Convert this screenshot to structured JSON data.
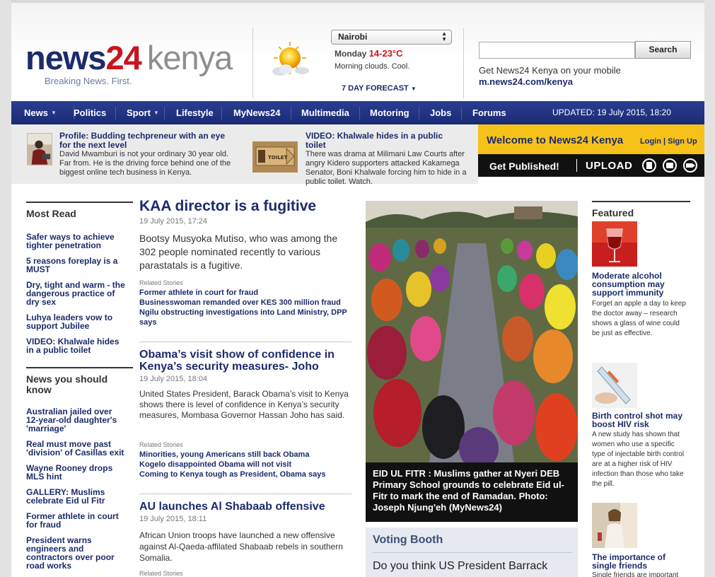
{
  "brand": {
    "logo_news": "news",
    "logo_24": "24",
    "logo_kenya": "kenya",
    "tagline": "Breaking News. First."
  },
  "weather": {
    "city": "Nairobi",
    "day": "Monday",
    "temp": "14-23°C",
    "condition": "Morning clouds. Cool.",
    "forecast_link": "7 DAY FORECAST",
    "icon": "sun-cloud-icon"
  },
  "search": {
    "value": "",
    "button": "Search"
  },
  "mobile": {
    "text": "Get News24 Kenya on your mobile",
    "link": "m.news24.com/kenya"
  },
  "nav": {
    "items": [
      "News",
      "Politics",
      "Sport",
      "Lifestyle",
      "MyNews24",
      "Multimedia",
      "Motoring",
      "Jobs",
      "Forums"
    ],
    "updated": "UPDATED: 19 July 2015, 18:20"
  },
  "teasers": [
    {
      "title": "Profile: Budding techpreneur with an eye for the next level",
      "body": "David Mwamburi is not your ordinary 30 year old. Far from. He is the driving force behind one of the biggest online tech business in Kenya."
    },
    {
      "title": "VIDEO: Khalwale hides in a public toilet",
      "body": "There was drama at Milimani Law Courts after angry Kidero supporters attacked Kakamega Senator, Boni Khalwale forcing him to hide in a public toilet. Watch.",
      "thumb_text": "TOILET"
    }
  ],
  "welcome": {
    "title": "Welcome to News24 Kenya",
    "login": "Login | Sign Up",
    "publish": "Get Published!",
    "upload": "UPLOAD"
  },
  "most_read": {
    "heading": "Most Read",
    "items": [
      "Safer ways to achieve tighter penetration",
      "5 reasons foreplay is a MUST",
      "Dry, tight and warm - the dangerous practice of dry sex",
      "Luhya leaders vow to support Jubilee",
      "VIDEO: Khalwale hides in a public toilet"
    ]
  },
  "should_know": {
    "heading": "News you should know",
    "items": [
      "Australian jailed over 12-year-old daughter's 'marriage'",
      "Real must move past 'division' of Casillas exit",
      "Wayne Rooney drops MLS hint",
      "GALLERY: Muslims celebrate Eid ul Fitr",
      "Former athlete in court for fraud",
      "President warns engineers and contractors over poor road works"
    ]
  },
  "articles": [
    {
      "headline": "KAA director is a fugitive",
      "date": "19 July 2015, 17:24",
      "summary": "Bootsy Musyoka Mutiso, who was among the 302 people nominated recently to various parastatals is a fugitive.",
      "related_label": "Related Stories",
      "related": [
        "Former athlete in court for fraud",
        "Businesswoman remanded over KES 300 million fraud",
        "Ngilu obstructing investigations into Land Ministry, DPP says"
      ]
    },
    {
      "headline": "Obama’s visit show of confidence in Kenya’s security measures- Joho",
      "date": "19 July 2015, 18:04",
      "summary": "United States President, Barack Obama’s visit to Kenya shows there is level of confidence in Kenya’s security measures, Mombasa Governor Hassan Joho has said.",
      "related_label": "Related Stories",
      "related": [
        "Minorities, young Americans still back Obama",
        "Kogelo disappointed Obama will not visit",
        "Coming to Kenya tough as President, Obama says"
      ]
    },
    {
      "headline": "AU launches Al Shabaab offensive",
      "date": "19 July 2015, 18:11",
      "summary": "African Union troops have launched a new offensive against Al-Qaeda-affilated Shabaab rebels in southern Somalia.",
      "related_label": "Related Stories"
    }
  ],
  "photo": {
    "caption": "EID UL FITR : Muslims gather at Nyeri DEB Primary School grounds to celebrate Eid ul-Fitr to mark the end of Ramadan. Photo: Joseph Njung'eh (MyNews24)"
  },
  "voting": {
    "title": "Voting Booth",
    "question": "Do you think US President Barrack"
  },
  "featured": {
    "heading": "Featured",
    "items": [
      {
        "title": "Moderate alcohol consumption may support immunity",
        "body": "Forget an apple a day to keep the doctor away – research shows a glass of wine could be just as effective."
      },
      {
        "title": "Birth control shot may boost HIV risk",
        "body": "A new study has shown that women who use a specific type of injectable birth control are at a higher risk of HIV infection than those who take the pill."
      },
      {
        "title": "The importance of single friends",
        "body": "Single friends are important"
      }
    ]
  },
  "colors": {
    "navy": "#1b2b6b",
    "red": "#c8141e",
    "gold": "#f6c21a"
  }
}
